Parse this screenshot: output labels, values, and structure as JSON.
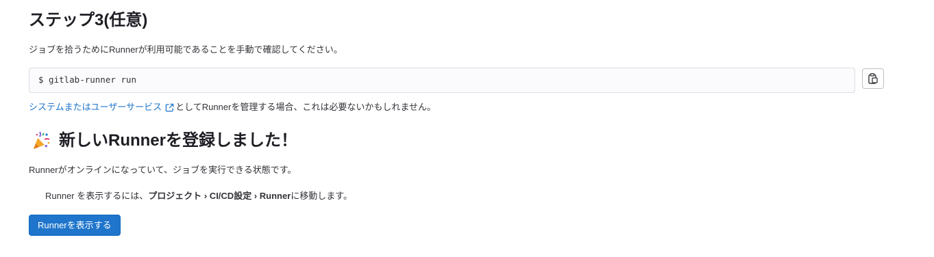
{
  "step": {
    "title": "ステップ3(任意)",
    "description": "ジョブを拾うためにRunnerが利用可能であることを手動で確認してください。",
    "command": "$ gitlab-runner run",
    "copy_icon": "clipboard-icon"
  },
  "note": {
    "link_text": "システムまたはユーザーサービス",
    "link_icon": "external-link-icon",
    "rest": "としてRunnerを管理する場合、これは必要ないかもしれません。"
  },
  "success": {
    "icon": "party-popper-icon",
    "title": "新しいRunnerを登録しました！",
    "online_text": "Runnerがオンラインになっていて、ジョブを実行できる状態です。",
    "nav_prefix": "Runner を表示するには、",
    "nav_path": "プロジェクト › CI/CD設定 › Runner",
    "nav_suffix": "に移動します。",
    "button_label": "Runnerを表示する"
  },
  "colors": {
    "link": "#1f75cb",
    "primary": "#1f75cb",
    "text": "#333238"
  }
}
